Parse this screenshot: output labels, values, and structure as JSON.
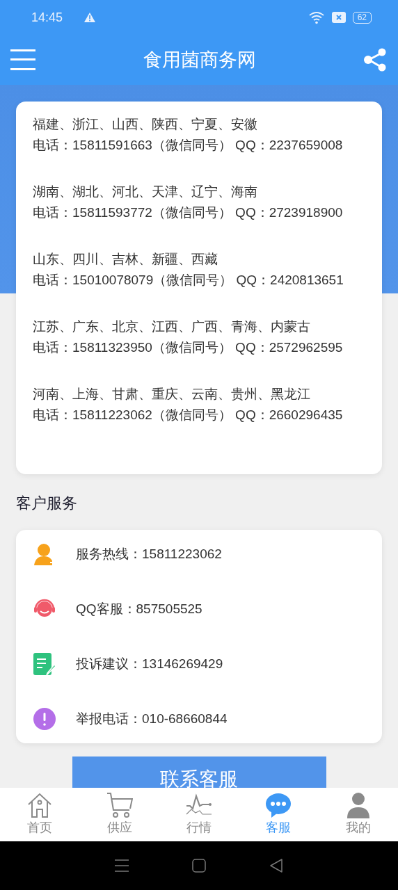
{
  "status_bar": {
    "time": "14:45",
    "battery": "62"
  },
  "header": {
    "title": "食用菌商务网"
  },
  "regions": [
    {
      "provinces": "福建、浙江、山西、陕西、宁夏、安徽",
      "contact": "电话：15811591663（微信同号） QQ：2237659008"
    },
    {
      "provinces": "湖南、湖北、河北、天津、辽宁、海南",
      "contact": "电话：15811593772（微信同号） QQ：2723918900"
    },
    {
      "provinces": "山东、四川、吉林、新疆、西藏",
      "contact": "电话：15010078079（微信同号） QQ：2420813651"
    },
    {
      "provinces": "江苏、广东、北京、江西、广西、青海、内蒙古",
      "contact": "电话：15811323950（微信同号） QQ：2572962595"
    },
    {
      "provinces": "河南、上海、甘肃、重庆、云南、贵州、黑龙江",
      "contact": "电话：15811223062（微信同号） QQ：2660296435"
    }
  ],
  "section_title": "客户服务",
  "services": [
    {
      "kind": "hotline",
      "label": "服务热线：15811223062"
    },
    {
      "kind": "qq",
      "label": "QQ客服：857505525"
    },
    {
      "kind": "complaint",
      "label": "投诉建议：13146269429"
    },
    {
      "kind": "report",
      "label": "举报电话：010-68660844"
    }
  ],
  "contact_button": "联系客服",
  "tabs": [
    {
      "kind": "home",
      "label": "首页",
      "selected": false
    },
    {
      "kind": "cart",
      "label": "供应",
      "selected": false
    },
    {
      "kind": "market",
      "label": "行情",
      "selected": false
    },
    {
      "kind": "chat",
      "label": "客服",
      "selected": true
    },
    {
      "kind": "user",
      "label": "我的",
      "selected": false
    }
  ]
}
